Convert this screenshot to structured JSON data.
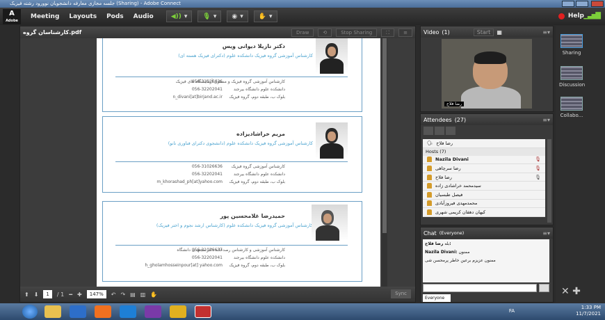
{
  "window": {
    "title": "جلسه مجازی معارفه دانشجویان نوورود رشته فیزیک (Sharing) - Adobe Connect"
  },
  "menubar": {
    "logo": "Adobe",
    "items": [
      "Meeting",
      "Layouts",
      "Pods",
      "Audio"
    ],
    "help": "Help"
  },
  "share": {
    "filename": "کارشناسان گروه.pdf",
    "buttons": [
      "Draw",
      "Stop Sharing"
    ],
    "page_current": "1",
    "page_total": "/ 1",
    "zoom": "147%",
    "sync": "Sync"
  },
  "cards": [
    {
      "name": "دکتر نازیلا دیوانی ویس",
      "subtitle": "کارشناس آموزشی گروه فیزیک دانشکده علوم (دکترای فیزیک هسته ای)",
      "lines_right": [
        "کارشناس آموزشی گروه فیزیک و مسئول آزمایشگاه های فیزیک",
        "دانشکده علوم دانشگاه بیرجند",
        "بلوک ب، طبقه دوم، گروه فیزیک"
      ],
      "lines_left": [
        "056-31026636",
        "056-32202041",
        "n_divani[at]birjand.ac.ir"
      ]
    },
    {
      "name": "مریم خراشادیزاده",
      "subtitle": "کارشناس آموزشی گروه فیزیک دانشکده علوم (دانشجوی دکترای فناوری نانو)",
      "lines_right": [
        "کارشناس آموزشی گروه فیزیک",
        "دانشکده علوم دانشگاه بیرجند",
        "بلوک ب، طبقه دوم، گروه فیزیک"
      ],
      "lines_left": [
        "056-31026636",
        "056-32202041",
        "m_khorashad_ph[at]yahoo.com"
      ]
    },
    {
      "name": "حمیدرضا غلامحسین پور",
      "subtitle": "کارشناس آموزشی گروه فیزیک دانشکده علوم (کارشناس ارشد نجوم و اختر فیزیک)",
      "lines_right": [
        "کارشناس آموزشی و کارشناس رصدخانه دکتر مجتهدی دانشگاه",
        "دانشکده علوم دانشگاه بیرجند",
        "بلوک ب، طبقه دوم، گروه فیزیک"
      ],
      "lines_left": [
        "056-31026637",
        "056-32202041",
        "h_gholamhosseinpour[at] yahoo.com"
      ]
    }
  ],
  "video": {
    "title": "Video",
    "count": "(1)",
    "start": "Start",
    "label": "رضا فلاح"
  },
  "attendees": {
    "title": "Attendees",
    "count": "(27)",
    "current": "رضا فلاح",
    "hosts_label": "Hosts (7)",
    "list": [
      "Nazila Divani",
      "رضا سرچاهی",
      "رضا فلاح",
      "سیدمحمد خراشادی زاده",
      "فیصل طبسیان",
      "محمدمهدی فیروزآبادی",
      "کیهان دهقان کریمی شهری"
    ]
  },
  "chat": {
    "title": "Chat",
    "scope": "(Everyone)",
    "messages": [
      {
        "from": "رضا فلاح:",
        "text": "بله"
      },
      {
        "from": "Nazila Divani:",
        "text": "ممنون"
      },
      {
        "from": "",
        "text": "ممنون عزیزم برعین خاطر پرمحسن شی"
      }
    ],
    "to": "Everyone"
  },
  "rail": {
    "items": [
      "Sharing",
      "Discussion",
      "Collabo..."
    ]
  },
  "taskbar": {
    "lang": "FA",
    "time": "1:33 PM",
    "date": "11/7/2021"
  }
}
